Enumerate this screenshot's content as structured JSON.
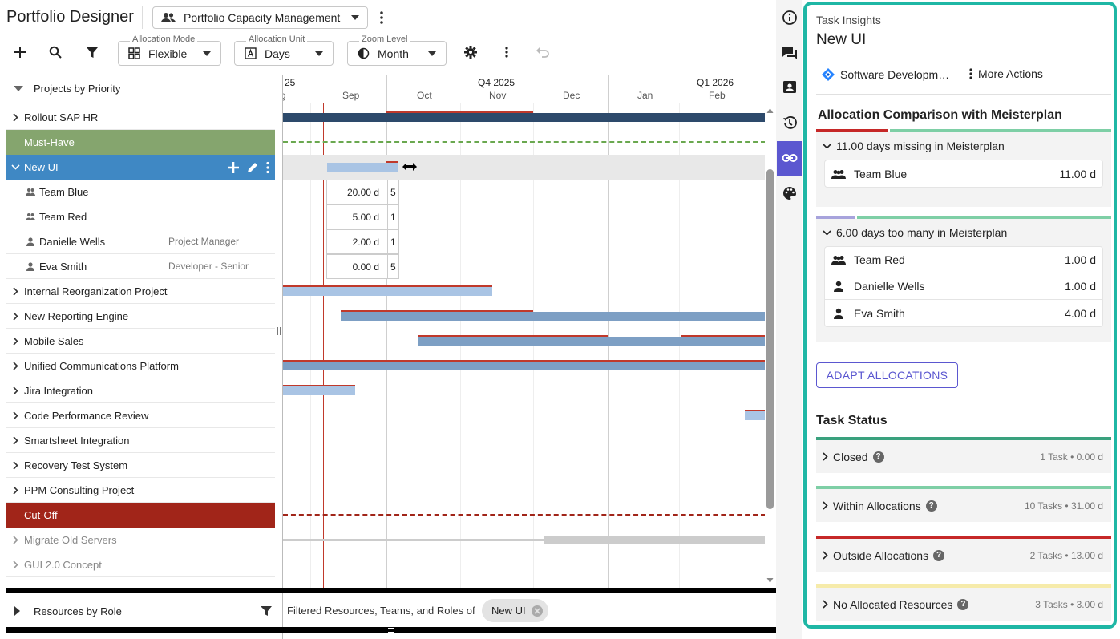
{
  "header": {
    "title": "Portfolio Designer",
    "portfolio": "Portfolio Capacity Management"
  },
  "toolbar": {
    "allocation_mode": {
      "label": "Allocation Mode",
      "value": "Flexible"
    },
    "allocation_unit": {
      "label": "Allocation Unit",
      "value": "Days"
    },
    "zoom_level": {
      "label": "Zoom Level",
      "value": "Month"
    }
  },
  "tree": {
    "header": "Projects by Priority",
    "rows": [
      {
        "label": "Rollout SAP HR"
      },
      {
        "label": "Must-Have"
      },
      {
        "label": "New UI"
      },
      {
        "label": "Team Blue"
      },
      {
        "label": "Team Red"
      },
      {
        "label": "Danielle Wells",
        "role": "Project Manager"
      },
      {
        "label": "Eva Smith",
        "role": "Developer - Senior"
      },
      {
        "label": "Internal Reorganization Project"
      },
      {
        "label": "New Reporting Engine"
      },
      {
        "label": "Mobile Sales"
      },
      {
        "label": "Unified Communications Platform"
      },
      {
        "label": "Jira Integration"
      },
      {
        "label": "Code Performance Review"
      },
      {
        "label": "Smartsheet Integration"
      },
      {
        "label": "Recovery Test System"
      },
      {
        "label": "PPM Consulting Project"
      },
      {
        "label": "Cut-Off"
      },
      {
        "label": "Migrate Old Servers"
      },
      {
        "label": "GUI 2.0 Concept"
      }
    ]
  },
  "gantt": {
    "quarters": [
      "25",
      "Q4 2025",
      "Q1 2026"
    ],
    "months": [
      "g",
      "Sep",
      "Oct",
      "Nov",
      "Dec",
      "Jan",
      "Feb"
    ],
    "allocations": [
      {
        "value": "20.00 d",
        "extra": "5"
      },
      {
        "value": "5.00 d",
        "extra": "1"
      },
      {
        "value": "2.00 d",
        "extra": "1"
      },
      {
        "value": "0.00 d",
        "extra": "5"
      }
    ]
  },
  "bottom": {
    "resources_label": "Resources by Role",
    "filter_text": "Filtered Resources, Teams, and Roles of",
    "chip": "New UI"
  },
  "panel": {
    "label": "Task Insights",
    "title": "New UI",
    "source": "Software Developm…",
    "more_actions": "More Actions",
    "comparison_title": "Allocation Comparison with Meisterplan",
    "missing": {
      "title": "11.00 days missing in Meisterplan",
      "items": [
        {
          "name": "Team Blue",
          "value": "11.00 d"
        }
      ]
    },
    "too_many": {
      "title": "6.00 days too many in Meisterplan",
      "items": [
        {
          "name": "Team Red",
          "value": "1.00 d"
        },
        {
          "name": "Danielle Wells",
          "value": "1.00 d"
        },
        {
          "name": "Eva Smith",
          "value": "4.00 d"
        }
      ]
    },
    "adapt_button": "ADAPT ALLOCATIONS",
    "status_title": "Task Status",
    "statuses": [
      {
        "label": "Closed",
        "count": "1 Task • 0.00 d",
        "color": "#3aa17e"
      },
      {
        "label": "Within Allocations",
        "count": "10 Tasks • 31.00 d",
        "color": "#7ecfa6"
      },
      {
        "label": "Outside Allocations",
        "count": "2 Tasks • 13.00 d",
        "color": "#c62828"
      },
      {
        "label": "No Allocated Resources",
        "count": "3 Tasks • 3.00 d",
        "color": "#f6ebaa"
      }
    ]
  },
  "colors": {
    "accent": "#5b57d0",
    "panel_border": "#1fb7a5",
    "must_have": "#85a56e",
    "cut_off": "#a12519",
    "selected": "#3f88c4"
  }
}
